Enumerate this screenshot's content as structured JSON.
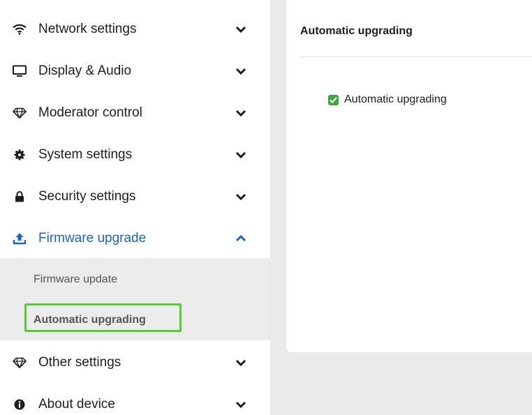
{
  "sidebar": {
    "items": [
      {
        "label": "Network settings",
        "icon": "wifi-icon",
        "expanded": false
      },
      {
        "label": "Display & Audio",
        "icon": "monitor-icon",
        "expanded": false
      },
      {
        "label": "Moderator control",
        "icon": "diamond-icon",
        "expanded": false
      },
      {
        "label": "System settings",
        "icon": "gear-icon",
        "expanded": false
      },
      {
        "label": "Security settings",
        "icon": "lock-icon",
        "expanded": false
      },
      {
        "label": "Firmware upgrade",
        "icon": "upload-icon",
        "expanded": true,
        "active": true
      },
      {
        "label": "Other settings",
        "icon": "diamond-icon",
        "expanded": false
      },
      {
        "label": "About device",
        "icon": "info-icon",
        "expanded": false
      }
    ],
    "submenu": [
      {
        "label": "Firmware update",
        "selected": false
      },
      {
        "label": "Automatic upgrading",
        "selected": true
      }
    ]
  },
  "content": {
    "title": "Automatic upgrading",
    "checkbox": {
      "label": "Automatic upgrading",
      "checked": true
    }
  },
  "colors": {
    "accent": "#1b63c9",
    "check_green": "#3fa73a",
    "highlight_green": "#55cc33",
    "submenu_bg": "#ebebeb",
    "page_bg": "#e9eaec"
  }
}
